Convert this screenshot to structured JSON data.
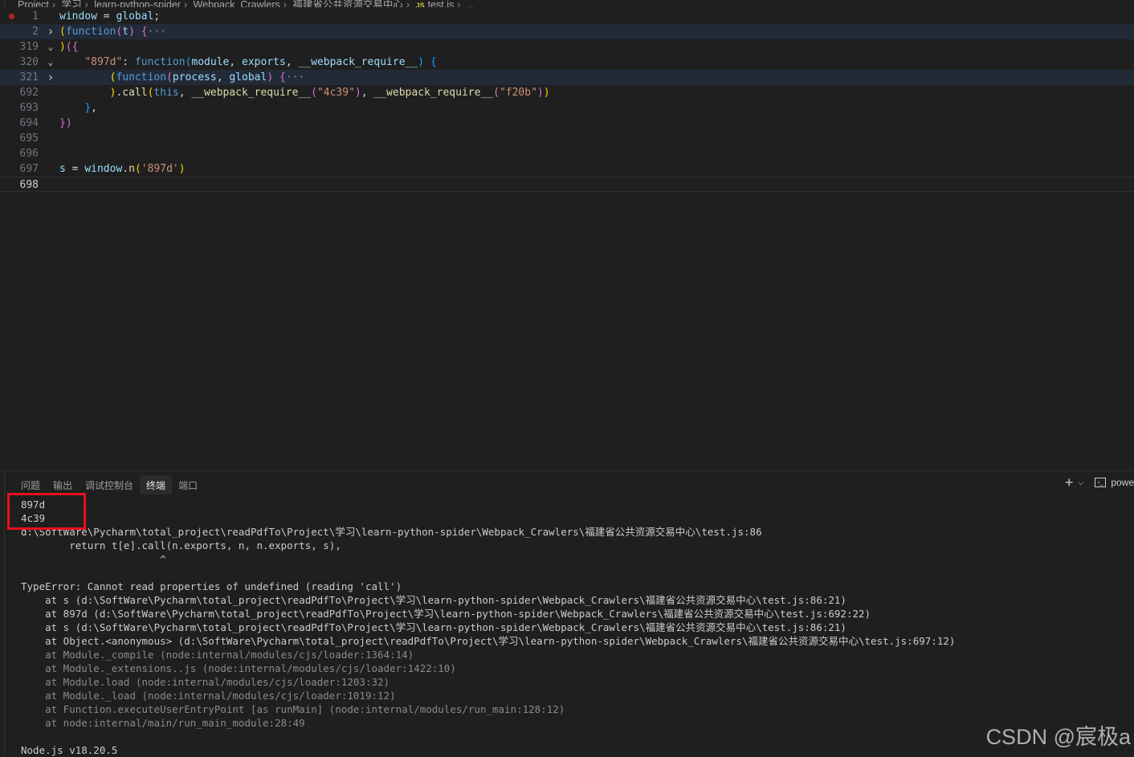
{
  "breadcrumb": {
    "items": [
      "Project",
      "学习",
      "learn-python-spider",
      "Webpack_Crawlers",
      "福建省公共资源交易中心"
    ],
    "file_icon": "JS",
    "file": "test.js",
    "more": "..."
  },
  "editor": {
    "lines": [
      {
        "num": "1",
        "fold": "",
        "tokens": [
          [
            "var",
            "window"
          ],
          [
            "pl",
            " = "
          ],
          [
            "var",
            "global"
          ],
          [
            "pl",
            ";"
          ]
        ]
      },
      {
        "num": "2",
        "fold": "right",
        "tokens": [
          [
            "br1",
            "("
          ],
          [
            "kw",
            "function"
          ],
          [
            "br2",
            "("
          ],
          [
            "var",
            "t"
          ],
          [
            "br2",
            ")"
          ],
          [
            "pl",
            " "
          ],
          [
            "br2",
            "{"
          ],
          [
            "ell",
            "···"
          ]
        ]
      },
      {
        "num": "319",
        "fold": "down",
        "tokens": [
          [
            "br1",
            ")"
          ],
          [
            "br2",
            "({"
          ]
        ]
      },
      {
        "num": "320",
        "fold": "down",
        "tokens": [
          [
            "pl",
            "    "
          ],
          [
            "str",
            "\"897d\""
          ],
          [
            "pl",
            ": "
          ],
          [
            "kw",
            "function"
          ],
          [
            "br3",
            "("
          ],
          [
            "var",
            "module"
          ],
          [
            "pl",
            ", "
          ],
          [
            "var",
            "exports"
          ],
          [
            "pl",
            ", "
          ],
          [
            "var",
            "__webpack_require__"
          ],
          [
            "br3",
            ")"
          ],
          [
            "pl",
            " "
          ],
          [
            "br3",
            "{"
          ]
        ]
      },
      {
        "num": "321",
        "fold": "right",
        "tokens": [
          [
            "pl",
            "        "
          ],
          [
            "br1",
            "("
          ],
          [
            "kw",
            "function"
          ],
          [
            "br2",
            "("
          ],
          [
            "var",
            "process"
          ],
          [
            "pl",
            ", "
          ],
          [
            "var",
            "global"
          ],
          [
            "br2",
            ")"
          ],
          [
            "pl",
            " "
          ],
          [
            "br2",
            "{"
          ],
          [
            "ell",
            "···"
          ]
        ]
      },
      {
        "num": "692",
        "fold": "",
        "tokens": [
          [
            "pl",
            "        "
          ],
          [
            "br1",
            ")"
          ],
          [
            "pl",
            "."
          ],
          [
            "fn",
            "call"
          ],
          [
            "br1",
            "("
          ],
          [
            "kw",
            "this"
          ],
          [
            "pl",
            ", "
          ],
          [
            "fn",
            "__webpack_require__"
          ],
          [
            "br2",
            "("
          ],
          [
            "str",
            "\"4c39\""
          ],
          [
            "br2",
            ")"
          ],
          [
            "pl",
            ", "
          ],
          [
            "fn",
            "__webpack_require__"
          ],
          [
            "br2",
            "("
          ],
          [
            "str",
            "\"f20b\""
          ],
          [
            "br2",
            ")"
          ],
          [
            "br1",
            ")"
          ]
        ]
      },
      {
        "num": "693",
        "fold": "",
        "tokens": [
          [
            "pl",
            "    "
          ],
          [
            "br3",
            "}"
          ],
          [
            "pl",
            ","
          ]
        ]
      },
      {
        "num": "694",
        "fold": "",
        "tokens": [
          [
            "br2",
            "})"
          ]
        ]
      },
      {
        "num": "695",
        "fold": "",
        "tokens": []
      },
      {
        "num": "696",
        "fold": "",
        "tokens": []
      },
      {
        "num": "697",
        "fold": "",
        "tokens": [
          [
            "var",
            "s"
          ],
          [
            "pl",
            " = "
          ],
          [
            "var",
            "window"
          ],
          [
            "pl",
            "."
          ],
          [
            "fn",
            "n"
          ],
          [
            "br1",
            "("
          ],
          [
            "str",
            "'897d'"
          ],
          [
            "br1",
            ")"
          ]
        ]
      },
      {
        "num": "698",
        "fold": "",
        "tokens": []
      }
    ]
  },
  "panel": {
    "tabs": [
      "问题",
      "输出",
      "调试控制台",
      "终端",
      "端口"
    ],
    "active_tab": "终端",
    "add_label": "+",
    "shell_label": "powe"
  },
  "terminal": {
    "lines": [
      {
        "t": "897d",
        "dim": false
      },
      {
        "t": "4c39",
        "dim": false
      },
      {
        "t": "d:\\SoftWare\\Pycharm\\total_project\\readPdfTo\\Project\\学习\\learn-python-spider\\Webpack_Crawlers\\福建省公共资源交易中心\\test.js:86",
        "dim": false
      },
      {
        "t": "        return t[e].call(n.exports, n, n.exports, s),",
        "dim": false
      },
      {
        "t": "                       ^",
        "dim": false
      },
      {
        "t": "",
        "dim": false
      },
      {
        "t": "TypeError: Cannot read properties of undefined (reading 'call')",
        "dim": false
      },
      {
        "t": "    at s (d:\\SoftWare\\Pycharm\\total_project\\readPdfTo\\Project\\学习\\learn-python-spider\\Webpack_Crawlers\\福建省公共资源交易中心\\test.js:86:21)",
        "dim": false
      },
      {
        "t": "    at 897d (d:\\SoftWare\\Pycharm\\total_project\\readPdfTo\\Project\\学习\\learn-python-spider\\Webpack_Crawlers\\福建省公共资源交易中心\\test.js:692:22)",
        "dim": false
      },
      {
        "t": "    at s (d:\\SoftWare\\Pycharm\\total_project\\readPdfTo\\Project\\学习\\learn-python-spider\\Webpack_Crawlers\\福建省公共资源交易中心\\test.js:86:21)",
        "dim": false
      },
      {
        "t": "    at Object.<anonymous> (d:\\SoftWare\\Pycharm\\total_project\\readPdfTo\\Project\\学习\\learn-python-spider\\Webpack_Crawlers\\福建省公共资源交易中心\\test.js:697:12)",
        "dim": false
      },
      {
        "t": "    at Module._compile (node:internal/modules/cjs/loader:1364:14)",
        "dim": true
      },
      {
        "t": "    at Module._extensions..js (node:internal/modules/cjs/loader:1422:10)",
        "dim": true
      },
      {
        "t": "    at Module.load (node:internal/modules/cjs/loader:1203:32)",
        "dim": true
      },
      {
        "t": "    at Module._load (node:internal/modules/cjs/loader:1019:12)",
        "dim": true
      },
      {
        "t": "    at Function.executeUserEntryPoint [as runMain] (node:internal/modules/run_main:128:12)",
        "dim": true
      },
      {
        "t": "    at node:internal/main/run_main_module:28:49",
        "dim": true
      },
      {
        "t": "",
        "dim": false
      },
      {
        "t": "Node.js v18.20.5",
        "dim": false
      }
    ]
  },
  "watermark": "CSDN @宸极a",
  "colors": {
    "background": "#1f1f1f",
    "highlight_box": "#e8101b",
    "breakpoint": "#b22222"
  }
}
